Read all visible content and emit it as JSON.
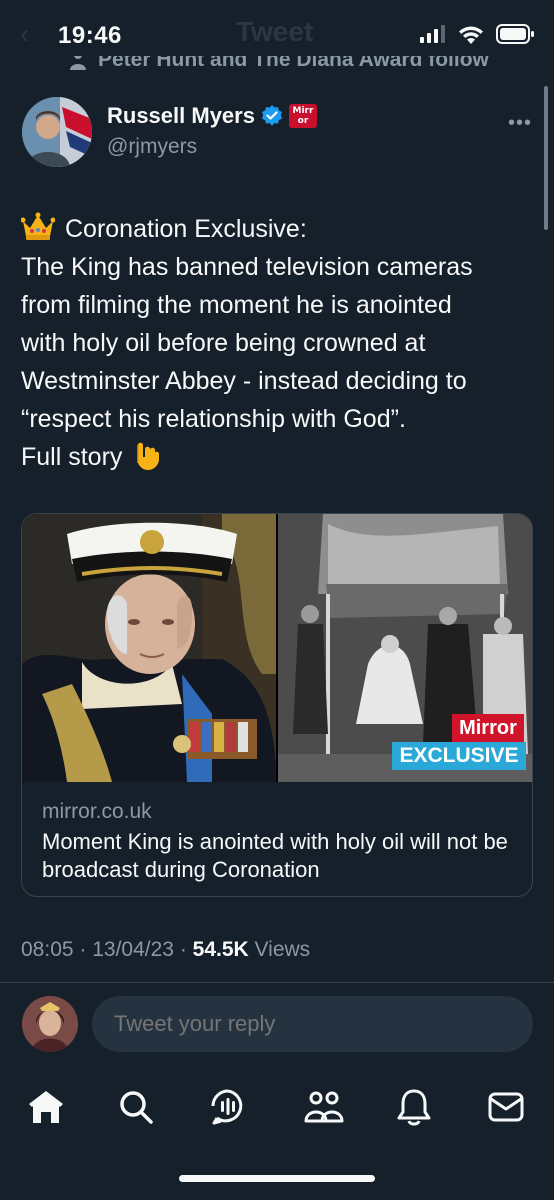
{
  "status_bar": {
    "time": "19:46",
    "ghost_back": "‹",
    "ghost_title": "Tweet",
    "icons": [
      "signal-icon",
      "wifi-icon",
      "battery-icon"
    ]
  },
  "social_context": "Peter Hunt and The Diana Award follow",
  "author": {
    "name": "Russell Myers",
    "handle": "@rjmyers",
    "affiliate_badge": "Mirr\nor",
    "more": "•••"
  },
  "tweet": {
    "line1": "Coronation Exclusive:",
    "body": "The King has banned television cameras\nfrom filming the moment he is anointed\nwith holy oil before being crowned at\nWestminster Abbey - instead deciding to\n“respect his relationship with God”.",
    "line_last": "Full story"
  },
  "card": {
    "mirror_label": "Mirror",
    "exclusive_label": "EXCLUSIVE",
    "domain": "mirror.co.uk",
    "title": "Moment King is anointed with holy oil will not be broadcast during Coronation"
  },
  "meta": {
    "time": "08:05",
    "sep1": " · ",
    "date": "13/04/23",
    "sep2": " · ",
    "views_count": "54.5K",
    "views_label": " Views"
  },
  "reply": {
    "placeholder": "Tweet your reply"
  },
  "nav": {
    "items": [
      "home-icon",
      "search-icon",
      "spaces-icon",
      "communities-icon",
      "notifications-icon",
      "messages-icon"
    ]
  },
  "colors": {
    "background": "#15202b",
    "text_primary": "#f7f9f9",
    "text_secondary": "#8b98a5",
    "verified_blue": "#1d9bf0",
    "mirror_red": "#d0152b",
    "exclusive_blue": "#2aa8d8",
    "border": "#38444d"
  }
}
